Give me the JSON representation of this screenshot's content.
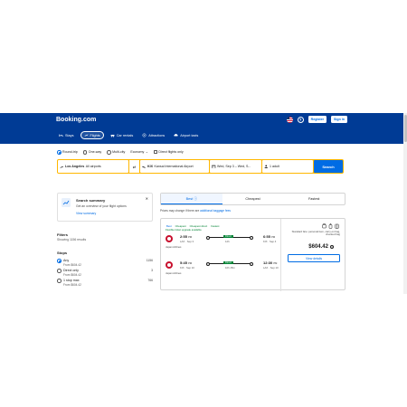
{
  "header": {
    "logo": "Booking.com",
    "register": "Register",
    "sign_in": "Sign in",
    "help": "?"
  },
  "nav": [
    {
      "label": "Stays",
      "icon": "bed-icon"
    },
    {
      "label": "Flights",
      "icon": "plane-icon",
      "active": true
    },
    {
      "label": "Car rentals",
      "icon": "car-icon"
    },
    {
      "label": "Attractions",
      "icon": "attractions-icon"
    },
    {
      "label": "Airport taxis",
      "icon": "taxi-icon"
    }
  ],
  "trip": {
    "round_trip": "Round-trip",
    "one_way": "One-way",
    "multi_city": "Multi-city",
    "cabin": "Economy",
    "direct_only": "Direct flights only"
  },
  "search": {
    "from_code": "Los Angeles",
    "from_rest": "All airports",
    "to_code": "KIX",
    "to_rest": "Kansai International Airport",
    "dates": "Wed, Sep 3 – Wed, S...",
    "travelers": "1 adult",
    "button": "Search",
    "swap": "⇄"
  },
  "summary": {
    "title": "Search summary",
    "desc": "Get an overview of your flight options",
    "link": "View summary",
    "close": "✕"
  },
  "filters": {
    "title": "Filters",
    "showing": "Showing 1156 results",
    "stops_title": "Stops",
    "stops": [
      {
        "label": "Any",
        "from": "From $604.42",
        "count": "1156",
        "selected": true
      },
      {
        "label": "Direct only",
        "from": "From $604.42",
        "count": "3",
        "selected": false
      },
      {
        "label": "1 stop max",
        "from": "From $604.42",
        "count": "766",
        "selected": false
      }
    ]
  },
  "tabs": [
    {
      "label": "Best",
      "active": true
    },
    {
      "label": "Cheapest"
    },
    {
      "label": "Fastest"
    }
  ],
  "price_note": "Prices may change if there are",
  "price_note_link": "additional baggage fees",
  "result": {
    "badges": [
      "Best",
      "Cheapest",
      "Cheapest direct",
      "Fastest"
    ],
    "flex_note": "Flexible ticket upgrade available",
    "legs": [
      {
        "dep": "2:55",
        "dep_ampm": "PM",
        "dep_sub": "LAX · Sep 3",
        "tag": "Direct",
        "dur": "12h",
        "arr": "6:55",
        "arr_ampm": "PM",
        "arr_sub": "KIX · Sep 4",
        "airline": "Japan Airlines"
      },
      {
        "dep": "5:45",
        "dep_ampm": "PM",
        "dep_sub": "KIX · Sep 10",
        "tag": "Direct",
        "dur": "10h 45m",
        "arr": "12:30",
        "arr_ampm": "PM",
        "arr_sub": "LAX · Sep 10",
        "airline": "Japan Airlines"
      }
    ],
    "fare_note": "Standard fare: personal item, carry-on bag, checked bag",
    "price": "$604.42",
    "details": "View details"
  }
}
